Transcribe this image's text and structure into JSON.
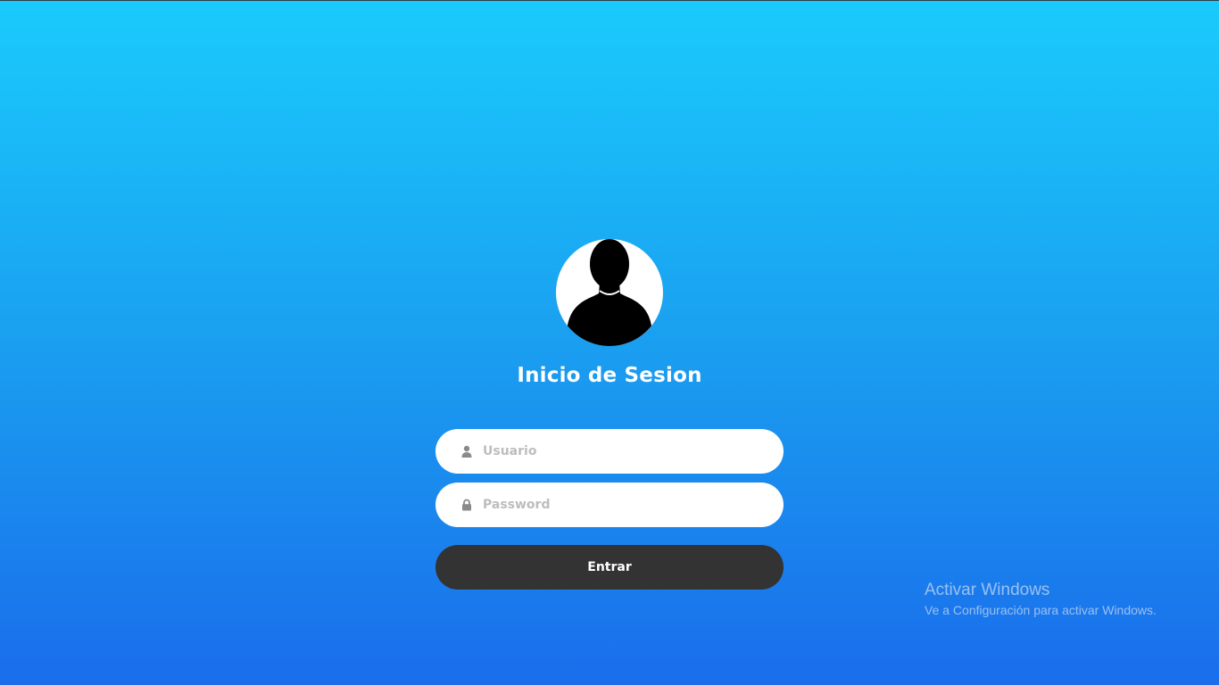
{
  "login": {
    "title": "Inicio de Sesion",
    "avatar_icon": "user-silhouette-icon",
    "username": {
      "icon": "user-icon",
      "placeholder": "Usuario",
      "value": ""
    },
    "password": {
      "icon": "lock-icon",
      "placeholder": "Password",
      "value": ""
    },
    "submit_label": "Entrar"
  },
  "watermark": {
    "title": "Activar Windows",
    "subtitle": "Ve a Configuración para activar Windows."
  },
  "colors": {
    "background_top": "#1acbfc",
    "background_bottom": "#1a6deb",
    "button": "#333333",
    "field": "#ffffff",
    "title": "#ffffff"
  }
}
